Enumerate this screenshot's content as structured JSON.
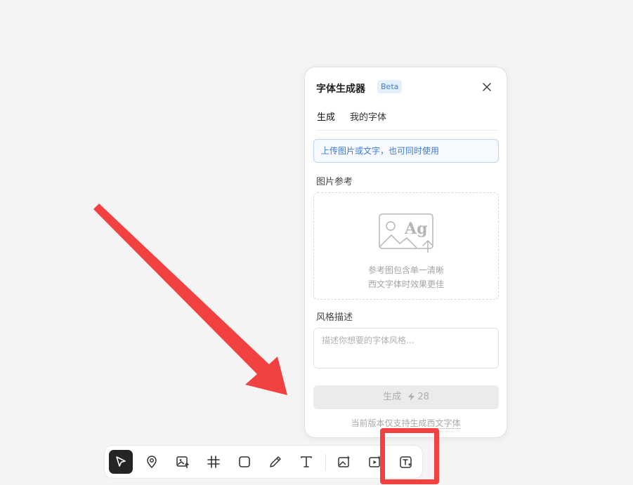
{
  "panel": {
    "title": "字体生成器",
    "badge": "Beta",
    "tabs": [
      {
        "label": "生成",
        "active": true
      },
      {
        "label": "我的字体",
        "active": false
      }
    ],
    "hint": "上传图片或文字，也可同时使用",
    "image_ref_label": "图片参考",
    "upload_icon_text": "Ag",
    "upload_hint_line1": "参考图包含单一清晰",
    "upload_hint_line2": "西文字体时效果更佳",
    "style_label": "风格描述",
    "style_placeholder": "描述你想要的字体风格...",
    "generate_label": "生成",
    "generate_cost": "28",
    "footer_prefix": "当前版本仅支持生成",
    "footer_emphasis": "西文字体"
  },
  "toolbar": {
    "tools": [
      "select-tool",
      "location-tool",
      "image-upload-tool",
      "frame-tool",
      "rectangle-tool",
      "pen-tool",
      "text-tool",
      "ai-image-tool",
      "ai-video-tool",
      "ai-font-tool"
    ],
    "active_tool": "select-tool"
  },
  "colors": {
    "accent": "#3c7bd9",
    "annotation": "#f24141",
    "active_tool_bg": "#252525"
  }
}
